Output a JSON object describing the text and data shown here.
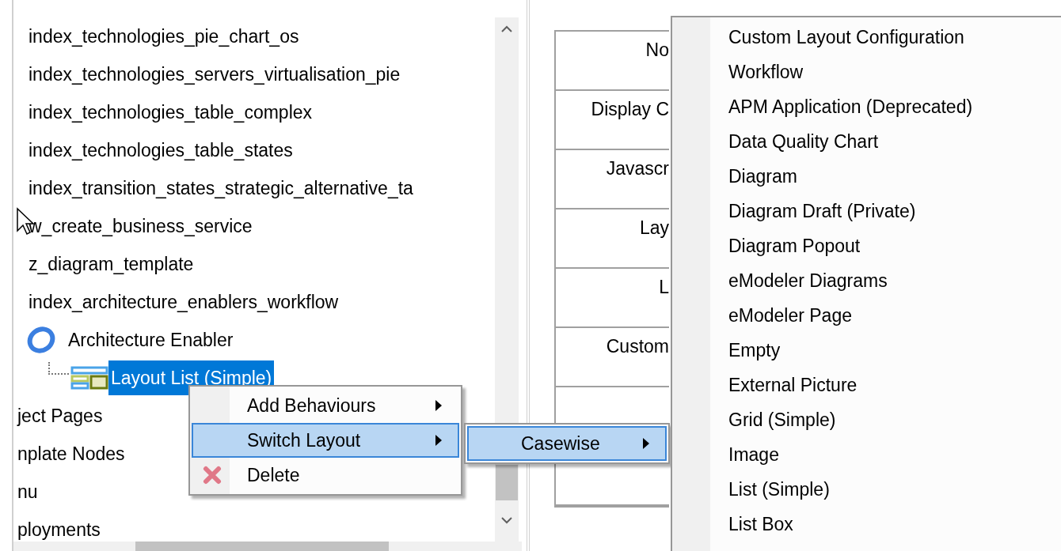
{
  "tree": {
    "scrolled_children": [
      {
        "label": "index_technologies_pie_chart_os",
        "kind": "plain",
        "selected": false
      },
      {
        "label": "index_technologies_servers_virtualisation_pie",
        "kind": "plain",
        "selected": false
      },
      {
        "label": "index_technologies_table_complex",
        "kind": "plain",
        "selected": false
      },
      {
        "label": "index_technologies_table_states",
        "kind": "plain",
        "selected": false
      },
      {
        "label": "index_transition_states_strategic_alternative_ta",
        "kind": "plain",
        "selected": false
      },
      {
        "label": "w_create_business_service",
        "kind": "plain",
        "selected": false
      },
      {
        "label": "z_diagram_template",
        "kind": "plain",
        "selected": false
      },
      {
        "label": "index_architecture_enablers_workflow",
        "kind": "plain",
        "selected": false
      },
      {
        "label": "Architecture Enabler",
        "kind": "object",
        "selected": false,
        "children": [
          {
            "label": "Layout List (Simple)",
            "kind": "layout",
            "selected": true
          }
        ]
      }
    ],
    "items": [
      {
        "label": "ject Pages",
        "selected": false
      },
      {
        "label": "nplate Nodes",
        "selected": false
      },
      {
        "label": "nu",
        "selected": false
      },
      {
        "label": "ployments",
        "selected": false
      }
    ]
  },
  "table": {
    "rows": [
      {
        "label": "No"
      },
      {
        "label": "Display C"
      },
      {
        "label": "Javascr"
      },
      {
        "label": "Lay"
      },
      {
        "label": "L"
      },
      {
        "label": "Custom"
      },
      {},
      {}
    ]
  },
  "context_menu": {
    "items": [
      {
        "label": "Add Behaviours",
        "kind": "submenu",
        "selected": false
      },
      {
        "label": "Switch Layout",
        "kind": "submenu",
        "selected": true
      },
      {
        "label": "Delete",
        "kind": "delete",
        "selected": false
      }
    ]
  },
  "submenu": {
    "items": [
      {
        "label": "Casewise",
        "kind": "submenu",
        "selected": true
      }
    ]
  },
  "layout_menu": {
    "items": [
      "Custom Layout Configuration",
      "Workflow",
      "APM Application (Deprecated)",
      "Data Quality Chart",
      "Diagram",
      "Diagram Draft (Private)",
      "Diagram Popout",
      "eModeler Diagrams",
      "eModeler Page",
      "Empty",
      "External Picture",
      "Grid (Simple)",
      "Image",
      "List (Simple)",
      "List Box"
    ]
  }
}
